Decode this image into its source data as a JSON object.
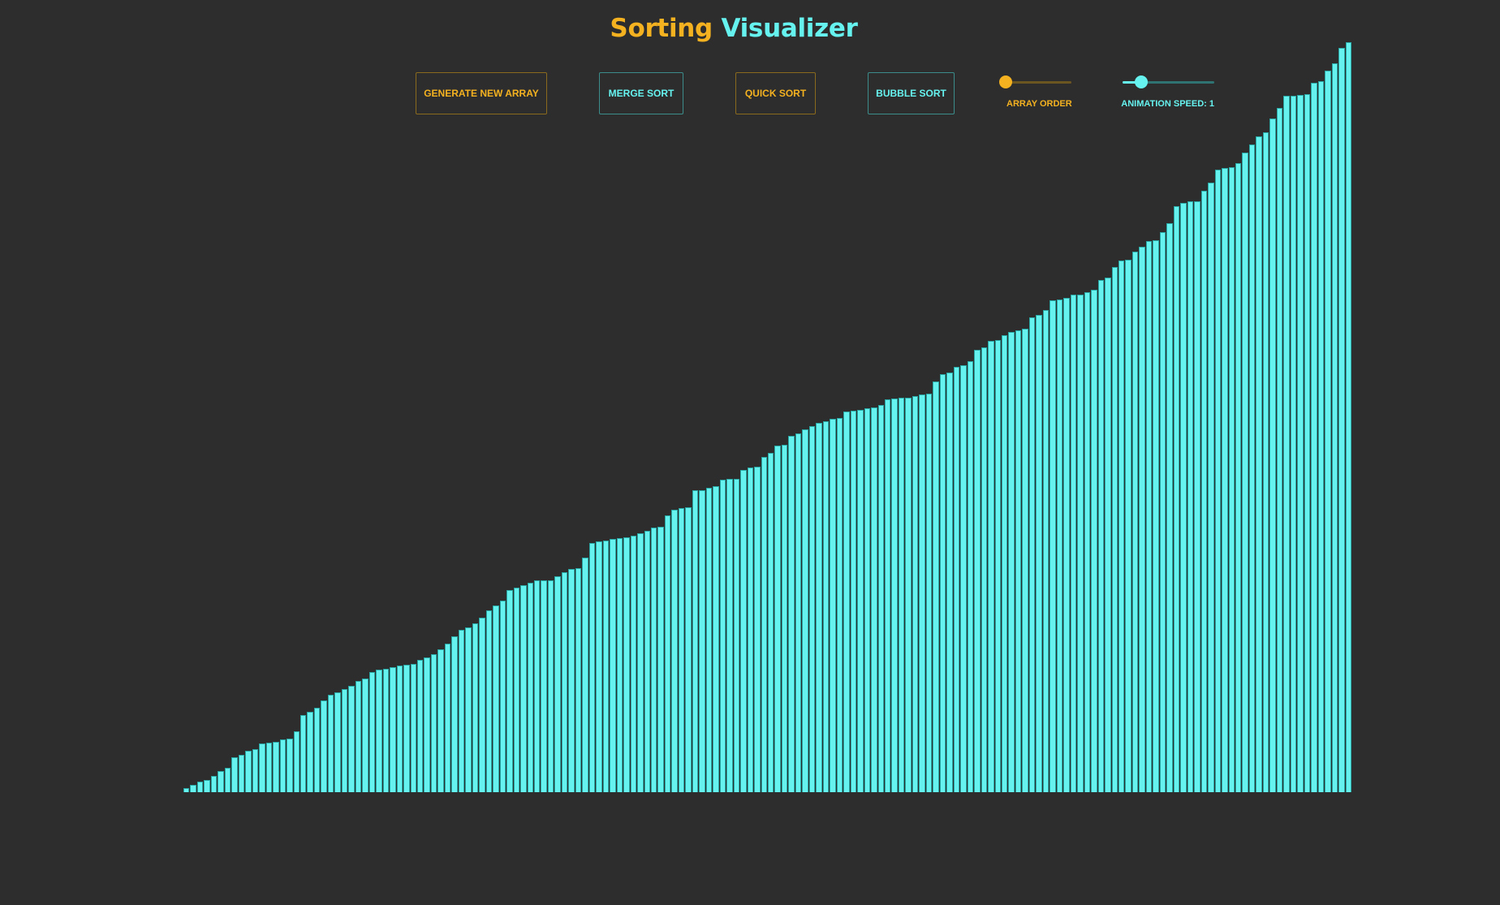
{
  "header": {
    "title_part1": "Sorting",
    "title_part2": "Visualizer"
  },
  "toolbar": {
    "generate_label": "GENERATE NEW ARRAY",
    "merge_label": "MERGE SORT",
    "quick_label": "QUICK SORT",
    "bubble_label": "BUBBLE SORT"
  },
  "sliders": {
    "array_order": {
      "label": "ARRAY ORDER",
      "value": 0
    },
    "animation_speed": {
      "label": "ANIMATION SPEED: 1",
      "value": 0.2
    }
  },
  "colors": {
    "accent_gold": "#f5b220",
    "accent_cyan": "#66f3f0",
    "background": "#2d2d2d",
    "bar": "#66f3f0"
  },
  "array": {
    "values": [
      5,
      9,
      13,
      15,
      20,
      26,
      30,
      43,
      46,
      51,
      53,
      60,
      61,
      62,
      65,
      66,
      75,
      95,
      99,
      104,
      113,
      120,
      123,
      127,
      131,
      137,
      140,
      148,
      151,
      152,
      154,
      156,
      157,
      158,
      163,
      166,
      170,
      176,
      183,
      192,
      200,
      203,
      208,
      215,
      224,
      230,
      236,
      249,
      252,
      255,
      258,
      261,
      261,
      261,
      266,
      271,
      275,
      276,
      289,
      307,
      309,
      310,
      312,
      313,
      314,
      316,
      319,
      322,
      326,
      327,
      341,
      348,
      350,
      351,
      372,
      372,
      375,
      377,
      385,
      386,
      386,
      397,
      400,
      401,
      413,
      418,
      427,
      428,
      439,
      442,
      447,
      451,
      455,
      457,
      460,
      461,
      469,
      470,
      471,
      473,
      474,
      477,
      484,
      485,
      486,
      486,
      488,
      490,
      491,
      506,
      515,
      517,
      524,
      526,
      531,
      545,
      548,
      556,
      557,
      563,
      567,
      569,
      571,
      585,
      588,
      594,
      606,
      607,
      609,
      613,
      613,
      616,
      619,
      631,
      634,
      647,
      655,
      656,
      666,
      672,
      679,
      680,
      690,
      701,
      722,
      726,
      728,
      728,
      741,
      751,
      767,
      769,
      770,
      775,
      788,
      798,
      808,
      813,
      830,
      843,
      858,
      858,
      859,
      860,
      874,
      876,
      889,
      898,
      917,
      924
    ]
  }
}
